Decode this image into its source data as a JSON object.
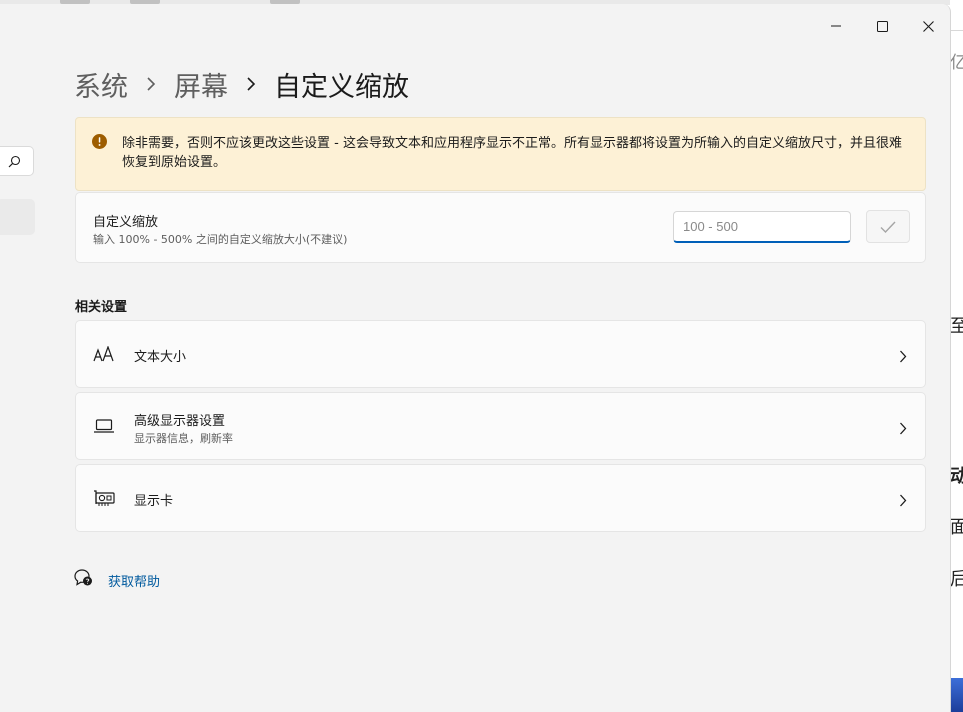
{
  "window": {
    "minimize_icon": "minimize-icon",
    "maximize_icon": "maximize-icon",
    "close_icon": "close-icon"
  },
  "nav": {
    "search_icon": "search-icon"
  },
  "breadcrumb": {
    "items": [
      "系统",
      "屏幕"
    ],
    "current": "自定义缩放"
  },
  "warning": {
    "icon": "warning-icon",
    "text": "除非需要，否则不应该更改这些设置 - 这会导致文本和应用程序显示不正常。所有显示器都将设置为所输入的自定义缩放尺寸，并且很难恢复到原始设置。"
  },
  "custom_scale": {
    "title": "自定义缩放",
    "description": "输入 100% - 500% 之间的自定义缩放大小(不建议)",
    "input_value": "",
    "input_placeholder": "100 - 500",
    "apply_icon": "checkmark-icon"
  },
  "related": {
    "heading": "相关设置",
    "items": [
      {
        "label": "文本大小",
        "sublabel": "",
        "icon": "text-size-icon"
      },
      {
        "label": "高级显示器设置",
        "sublabel": "显示器信息，刷新率",
        "icon": "laptop-icon"
      },
      {
        "label": "显示卡",
        "sublabel": "",
        "icon": "graphics-card-icon"
      }
    ]
  },
  "help": {
    "label": "获取帮助",
    "icon": "help-icon"
  },
  "background_fragments": [
    "亿",
    "至",
    "动】",
    "面",
    "后"
  ],
  "colors": {
    "accent": "#005fb8",
    "link": "#005a9e",
    "warning_bg": "#fdf1d6",
    "warning_icon": "#9d5d00",
    "window_bg": "#f3f3f3",
    "card_bg": "#fbfbfb"
  }
}
